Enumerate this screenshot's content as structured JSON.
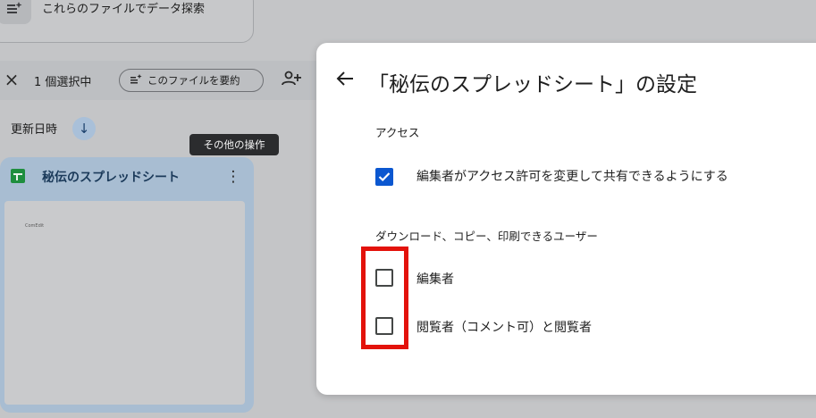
{
  "background": {
    "explore_label": "これらのファイルでデータ探索",
    "selection": {
      "count_label": "1 個選択中",
      "summarize_label": "このファイルを要約"
    },
    "sort_label": "更新日時",
    "tooltip": "その他の操作",
    "file": {
      "name": "秘伝のスプレッドシート",
      "thumb_cell": "ComEdit"
    }
  },
  "dialog": {
    "title": "「秘伝のスプレッドシート」の設定",
    "access_heading": "アクセス",
    "editor_share_label": "編集者がアクセス許可を変更して共有できるようにする",
    "editor_share_checked": true,
    "download_heading": "ダウンロード、コピー、印刷できるユーザー",
    "options": [
      {
        "label": "編集者",
        "checked": false
      },
      {
        "label": "閲覧者（コメント可）と閲覧者",
        "checked": false
      }
    ]
  },
  "colors": {
    "checkbox_checked": "#0b57d0",
    "highlight": "#e3120b",
    "sheets_green": "#1e8e3e"
  }
}
